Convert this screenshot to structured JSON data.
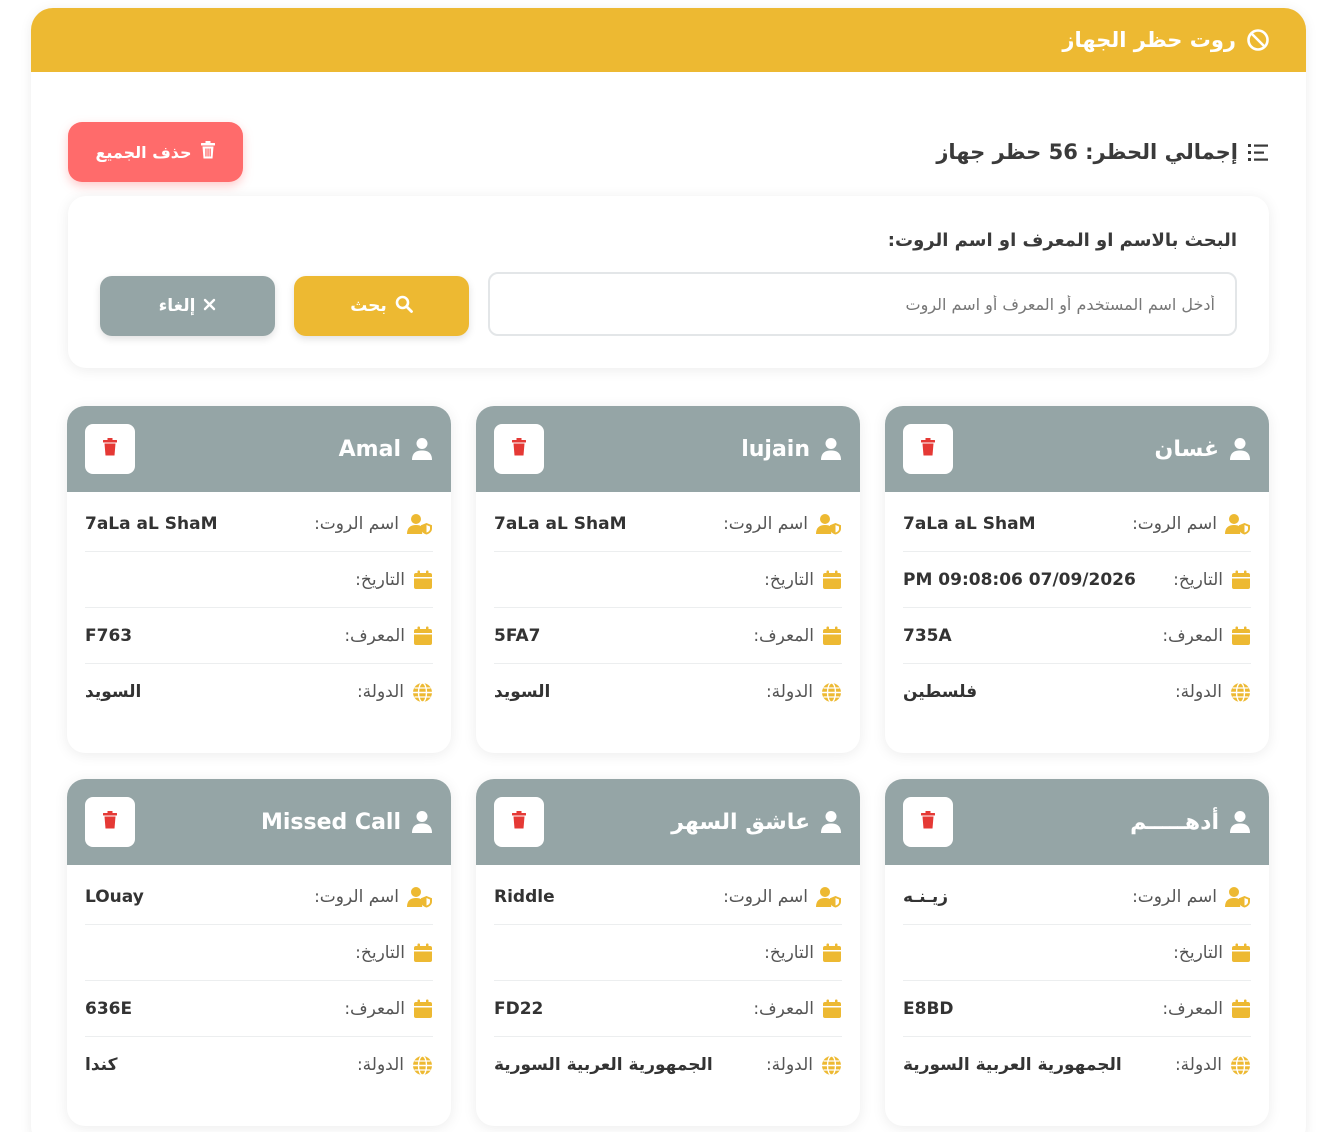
{
  "header": {
    "title": "روت حظر الجهاز",
    "icon": "ban-icon",
    "color": "#edb932"
  },
  "summary": {
    "label": "إجمالي الحظر: 56 حظر جهاز",
    "icon": "list-icon"
  },
  "delete_all": {
    "label": "حذف الجميع",
    "icon": "trash-icon",
    "color": "#ff6b6b"
  },
  "search": {
    "label": "البحث بالاسم او المعرف او اسم الروت:",
    "placeholder": "أدخل اسم المستخدم أو المعرف أو اسم الروت",
    "value": "",
    "search_button": "بحث",
    "cancel_button": "إلغاء"
  },
  "labels": {
    "room": "اسم الروت:",
    "date": "التاريخ:",
    "id": "المعرف:",
    "country": "الدولة:"
  },
  "cards": [
    {
      "name": "غسان",
      "room": "7aLa aL ShaM",
      "date": "PM 09:08:06 07/09/2026",
      "id": "735A",
      "country": "فلسطين"
    },
    {
      "name": "lujain",
      "room": "7aLa aL ShaM",
      "date": "",
      "id": "5FA7",
      "country": "السويد"
    },
    {
      "name": "Amal",
      "room": "7aLa aL ShaM",
      "date": "",
      "id": "F763",
      "country": "السويد"
    },
    {
      "name": "أدهـــــم",
      "room": "زيـنـه",
      "date": "",
      "id": "E8BD",
      "country": "الجمهورية العربية السورية"
    },
    {
      "name": "عاشق السهر",
      "room": "Riddle",
      "date": "",
      "id": "FD22",
      "country": "الجمهورية العربية السورية"
    },
    {
      "name": "Missed Call",
      "room": "LOuay",
      "date": "",
      "id": "636E",
      "country": "كندا"
    }
  ]
}
